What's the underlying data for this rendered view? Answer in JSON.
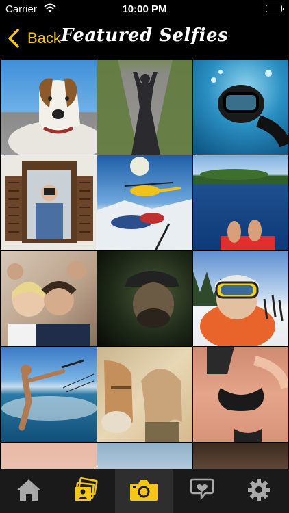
{
  "status_bar": {
    "carrier": "Carrier",
    "time": "10:00 PM"
  },
  "nav": {
    "back_label": "Back",
    "title": "Featured Selfies"
  },
  "colors": {
    "accent": "#f5c61a",
    "icon_gray": "#a9a9a9"
  },
  "grid": {
    "tiles": [
      {
        "subject": "dog-selfie"
      },
      {
        "subject": "shadow-on-road"
      },
      {
        "subject": "underwater-diver"
      },
      {
        "subject": "man-in-window-frame"
      },
      {
        "subject": "helicopter-snow"
      },
      {
        "subject": "lake-feet"
      },
      {
        "subject": "group-selfie"
      },
      {
        "subject": "dark-cap-portrait"
      },
      {
        "subject": "ski-goggles"
      },
      {
        "subject": "kitesurfer"
      },
      {
        "subject": "horse-and-woman"
      },
      {
        "subject": "beach-selfie"
      },
      {
        "subject": "partial-photo-1"
      },
      {
        "subject": "partial-photo-2"
      },
      {
        "subject": "partial-photo-3"
      }
    ]
  },
  "tab_bar": {
    "tabs": [
      {
        "icon": "home-icon",
        "selected": false
      },
      {
        "icon": "photos-icon",
        "selected": false
      },
      {
        "icon": "camera-icon",
        "selected": true
      },
      {
        "icon": "chat-icon",
        "selected": false
      },
      {
        "icon": "settings-icon",
        "selected": false
      }
    ]
  }
}
